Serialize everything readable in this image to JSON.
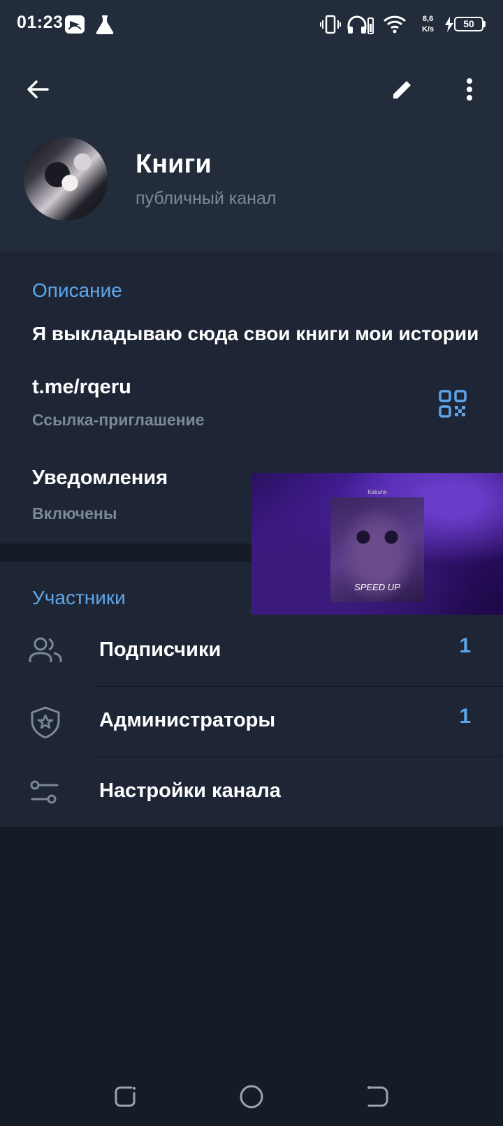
{
  "status_bar": {
    "time": "01:23",
    "speed_value": "8,6",
    "speed_unit": "K/s",
    "battery": "50"
  },
  "channel": {
    "title": "Книги",
    "subtitle": "публичный канал"
  },
  "info": {
    "description_label": "Описание",
    "description_text": "Я выкладываю сюда свои книги мои истории",
    "link": "t.me/rqeru",
    "link_label": "Ссылка-приглашение",
    "notifications_title": "Уведомления",
    "notifications_status": "Включены"
  },
  "media_overlay": {
    "top_text": "Kabunn",
    "caption": "SPEED UP"
  },
  "members": {
    "section_label": "Участники",
    "items": [
      {
        "label": "Подписчики",
        "count": "1",
        "icon": "people-icon"
      },
      {
        "label": "Администраторы",
        "count": "1",
        "icon": "shield-star-icon"
      },
      {
        "label": "Настройки канала",
        "count": "",
        "icon": "settings-sliders-icon"
      }
    ]
  },
  "colors": {
    "accent": "#5ea6ea",
    "header_bg": "#222c3b",
    "card_bg": "#1e2636",
    "page_bg": "#161c27"
  }
}
